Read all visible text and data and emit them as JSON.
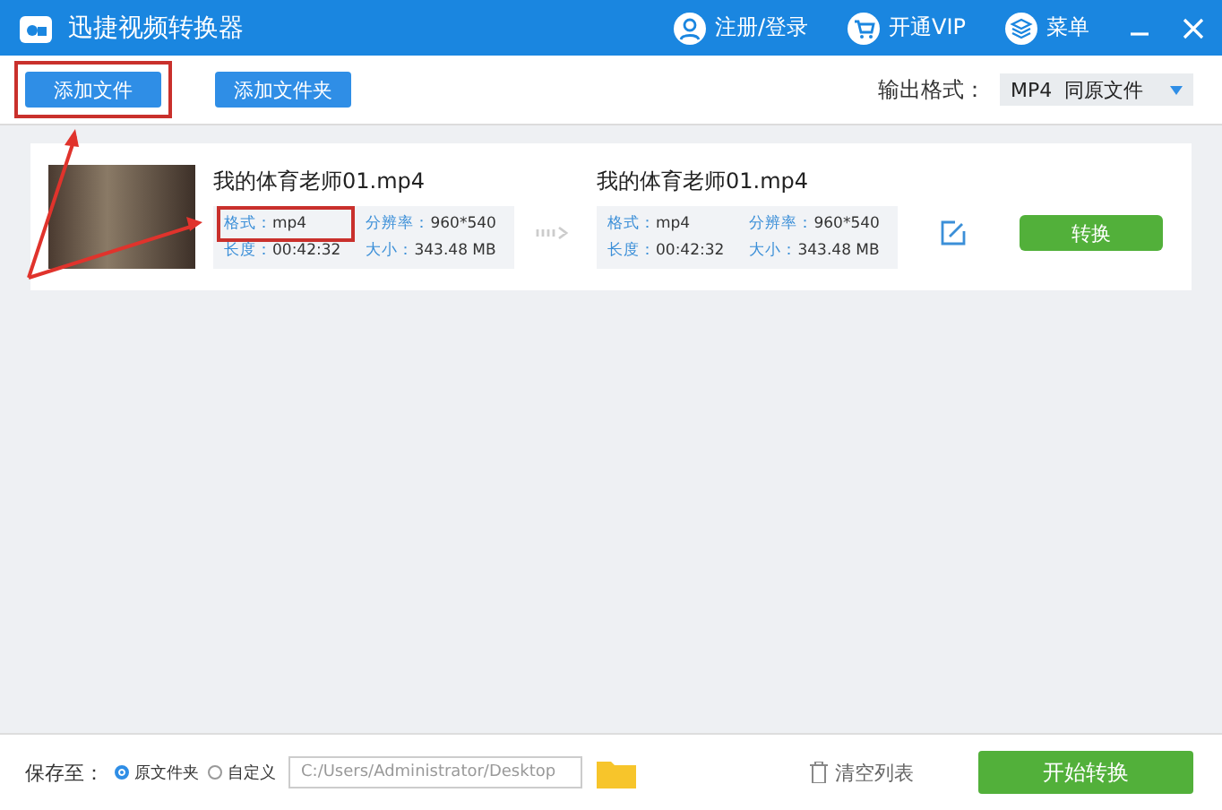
{
  "window": {
    "title": "迅捷视频转换器"
  },
  "header_actions": [
    {
      "kind": "user",
      "label": "注册/登录"
    },
    {
      "kind": "cart",
      "label": "开通VIP"
    },
    {
      "kind": "layers",
      "label": "菜单"
    }
  ],
  "toolbar": {
    "buttons": [
      {
        "label": "添加文件",
        "highlighted": true
      },
      {
        "label": "添加文件夹",
        "highlighted": false
      }
    ],
    "output_format": {
      "label": "输出格式：",
      "value": "MP4  同原文件"
    }
  },
  "files": [
    {
      "name": "我的体育老师01.mp4",
      "info": [
        {
          "label": "格式：",
          "value": "mp4",
          "highlighted": true
        },
        {
          "label": "分辨率：",
          "value": "960*540",
          "highlighted": false
        },
        {
          "label": "长度：",
          "value": "00:42:32",
          "highlighted": false
        },
        {
          "label": "大小：",
          "value": "343.48 MB",
          "highlighted": false
        }
      ],
      "output_name": "我的体育老师01.mp4",
      "output_info": [
        {
          "label": "格式：",
          "value": "mp4"
        },
        {
          "label": "分辨率：",
          "value": "960*540"
        },
        {
          "label": "长度：",
          "value": "00:42:32"
        },
        {
          "label": "大小：",
          "value": "343.48 MB"
        }
      ],
      "convert_button": "转换"
    }
  ],
  "bottom_bar": {
    "label": "保存至：",
    "options": [
      {
        "label": "原文件夹",
        "selected": true
      },
      {
        "label": "自定义",
        "selected": false
      }
    ],
    "path": "C:/Users/Administrator/Desktop",
    "clear_button": "清空列表",
    "start_button": "开始转换"
  }
}
